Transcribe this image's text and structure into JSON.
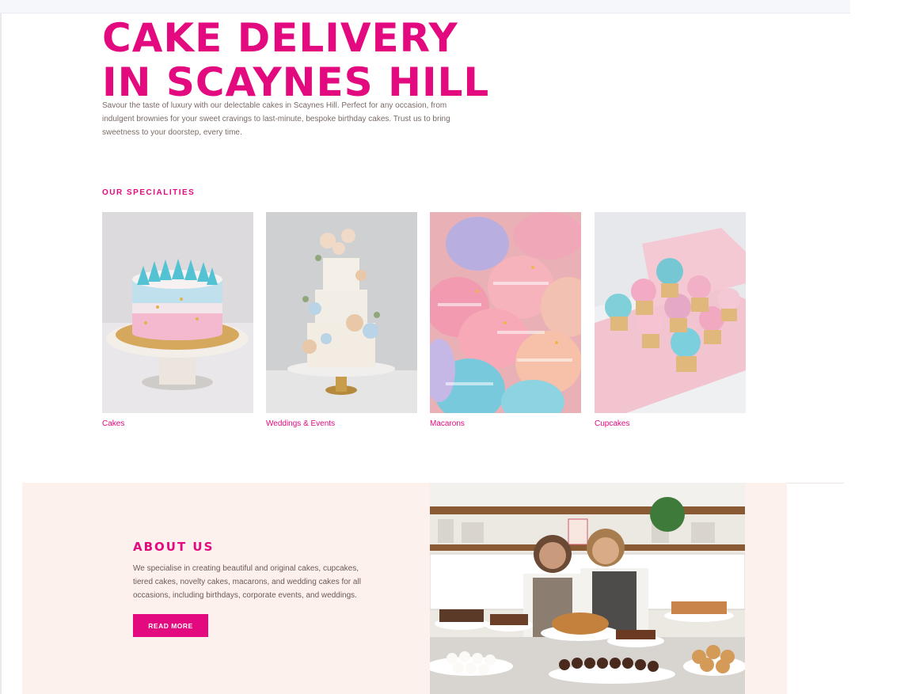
{
  "hero": {
    "title_line1": "CAKE DELIVERY",
    "title_line2": "IN SCAYNES HILL",
    "description": "Savour the taste of luxury with our delectable cakes in Scaynes Hill. Perfect for any occasion, from indulgent brownies for your sweet cravings to last-minute, bespoke birthday cakes. Trust us to bring sweetness to your doorstep, every time."
  },
  "specialities": {
    "heading": "OUR SPECIALITIES",
    "items": [
      {
        "label": "Cakes",
        "image": "cake-photo"
      },
      {
        "label": "Weddings & Events",
        "image": "wedding-cake-photo"
      },
      {
        "label": "Macarons",
        "image": "macarons-photo"
      },
      {
        "label": "Cupcakes",
        "image": "cupcakes-photo"
      }
    ]
  },
  "about": {
    "title": "ABOUT US",
    "text": "We specialise in creating beautiful and original cakes, cupcakes, tiered cakes, novelty cakes, macarons, and wedding cakes for all occasions, including birthdays, corporate events, and weddings.",
    "button_label": "READ MORE",
    "image": "bakers-photo"
  },
  "colors": {
    "accent": "#e3097f",
    "body_text": "#7a6b66",
    "about_background": "#fdf1ee",
    "page_background": "#ffffff"
  }
}
